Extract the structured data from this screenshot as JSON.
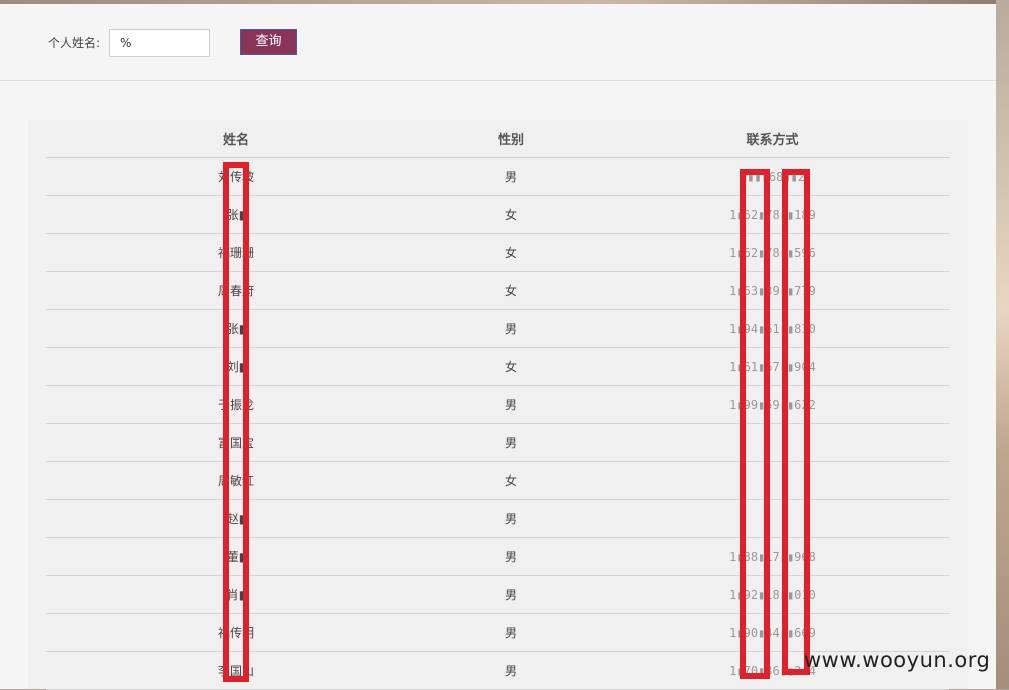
{
  "search": {
    "label": "个人姓名:",
    "value": "%",
    "button_label": "查询"
  },
  "table": {
    "headers": [
      "姓名",
      "性别",
      "联系方式"
    ],
    "rows": [
      {
        "name": "刘传坡",
        "gender": "男",
        "phone": "1▮▮▮68▮▮2"
      },
      {
        "name": "张▮",
        "gender": "女",
        "phone": "1▮62▮78▮▮189"
      },
      {
        "name": "福珊珊",
        "gender": "女",
        "phone": "1▮62▮78▮▮596"
      },
      {
        "name": "周春府",
        "gender": "女",
        "phone": "1▮63▮39▮▮779"
      },
      {
        "name": "张▮",
        "gender": "男",
        "phone": "1▮94▮61▮▮830"
      },
      {
        "name": "刘▮",
        "gender": "女",
        "phone": "1▮61▮67▮▮904"
      },
      {
        "name": "于振龙",
        "gender": "男",
        "phone": "1▮99▮59▮▮622"
      },
      {
        "name": "富国宝",
        "gender": "男",
        "phone": ""
      },
      {
        "name": "周敏红",
        "gender": "女",
        "phone": ""
      },
      {
        "name": "赵▮",
        "gender": "男",
        "phone": ""
      },
      {
        "name": "董▮",
        "gender": "男",
        "phone": "1▮38▮17▮▮968"
      },
      {
        "name": "肖▮",
        "gender": "男",
        "phone": "1▮92▮18▮▮010"
      },
      {
        "name": "福传明",
        "gender": "男",
        "phone": "1▮90▮44▮▮669"
      },
      {
        "name": "李国山",
        "gender": "男",
        "phone": "1▮70▮36▮▮344"
      }
    ]
  },
  "watermark": "www.wooyun.org",
  "colors": {
    "button_bg": "#8a3557",
    "redaction": "#e0202b"
  }
}
